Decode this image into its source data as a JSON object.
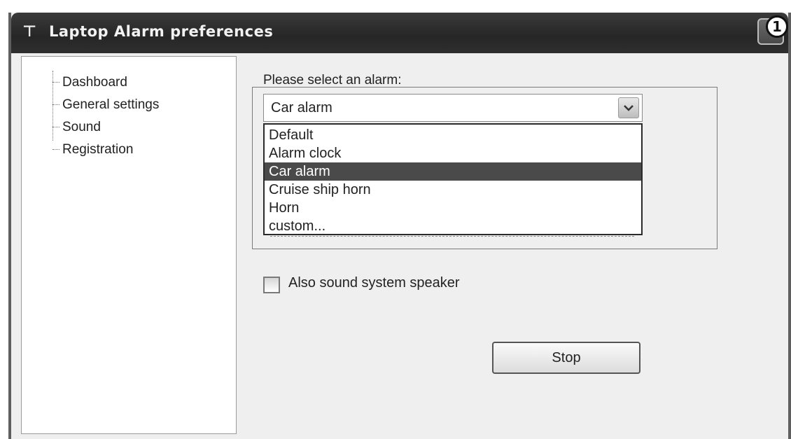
{
  "window": {
    "title": "Laptop Alarm preferences",
    "app_icon": "alarm-symbol-icon",
    "badge": "1"
  },
  "tree": {
    "items": [
      {
        "label": "Dashboard"
      },
      {
        "label": "General settings"
      },
      {
        "label": "Sound"
      },
      {
        "label": "Registration"
      }
    ]
  },
  "alarm": {
    "prompt": "Please select an alarm:",
    "selected": "Car alarm",
    "options": [
      "Default",
      "Alarm clock",
      "Car alarm",
      "Cruise ship horn",
      "Horn",
      "custom..."
    ],
    "selected_index": 2
  },
  "speaker": {
    "label": "Also sound system speaker",
    "checked": false
  },
  "actions": {
    "stop_label": "Stop"
  },
  "colors": {
    "titlebar": "#2b2b2b",
    "selection": "#4a4a4a"
  }
}
